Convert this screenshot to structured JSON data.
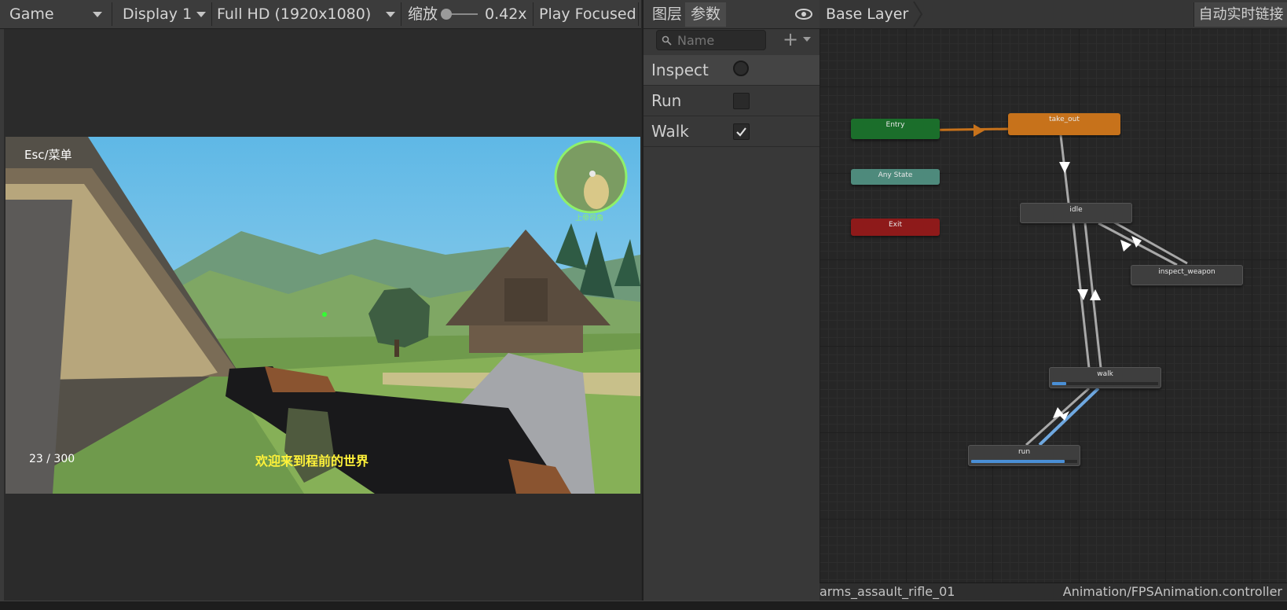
{
  "game_toolbar": {
    "view_label": "Game",
    "display_label": "Display 1",
    "resolution_label": "Full HD (1920x1080)",
    "scale_label": "缩放",
    "scale_value": "0.42x",
    "scale_fraction": 0.05,
    "play_mode_label": "Play Focused"
  },
  "hud": {
    "menu_hint": "Esc/菜单",
    "ammo": "23 / 300",
    "subtitle": "欢迎来到程前的世界",
    "minimap_label": "上帝视角",
    "subtitle_color": "#fff23a",
    "minimap_ring_color": "#8ff06a"
  },
  "params_panel": {
    "tabs": [
      "图层",
      "参数"
    ],
    "active_tab": "参数",
    "search_placeholder": "Name",
    "params": [
      {
        "name": "Inspect",
        "type": "trigger",
        "value": false
      },
      {
        "name": "Run",
        "type": "bool",
        "value": false
      },
      {
        "name": "Walk",
        "type": "bool",
        "value": true
      }
    ]
  },
  "animator": {
    "layer_breadcrumb": "Base Layer",
    "live_link_label": "自动实时链接",
    "states": {
      "entry": "Entry",
      "any_state": "Any State",
      "exit": "Exit",
      "take_out": "take_out",
      "idle": "idle",
      "inspect_weapon": "inspect_weapon",
      "walk": "walk",
      "run": "run"
    },
    "walk_progress": 0.13,
    "run_progress": 0.87,
    "colors": {
      "entry": "#1b6e2b",
      "any_state": "#4e8a7c",
      "exit": "#8e1a1a",
      "default_state": "#c7721b",
      "state": "#3e3e3e",
      "active_transition": "#6fa8e0"
    }
  },
  "status_bar": {
    "left_text": "arms_assault_rifle_01",
    "right_text": "Animation/FPSAnimation.controller"
  }
}
